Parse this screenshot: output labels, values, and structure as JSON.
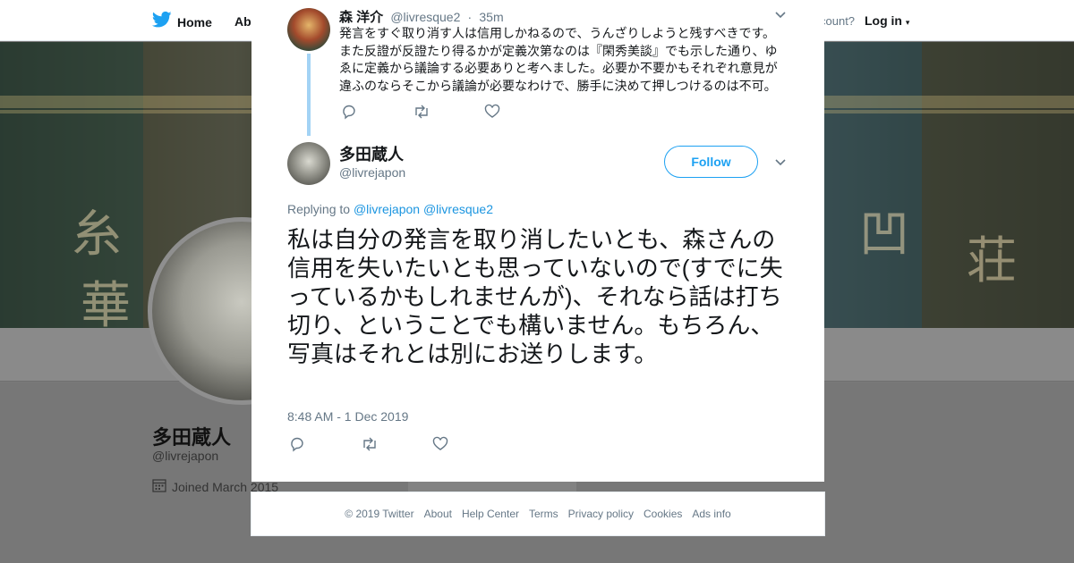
{
  "topbar": {
    "home_label": "Home",
    "about_label": "Abo",
    "account_prompt": "count?",
    "login_label": "Log in"
  },
  "profile": {
    "name": "多田蔵人",
    "handle": "@livrejapon",
    "joined": "Joined March 2015"
  },
  "reply_tweet": {
    "author_name": "森 洋介",
    "author_handle": "@livresque2",
    "separator": "·",
    "time_ago": "35m",
    "text": "発言をすぐ取り消す人は信用しかねるので、うんざりしようと残すべきです。また反證が反證たり得るかが定義次第なのは『閑秀美談』でも示した通り、ゆゑに定義から議論する必要ありと考へました。必要か不要かもそれぞれ意見が違ふのならそこから議論が必要なわけで、勝手に決めて押しつけるのは不可。"
  },
  "main_tweet": {
    "author_name": "多田蔵人",
    "author_handle": "@livrejapon",
    "follow_label": "Follow",
    "replying_prefix": "Replying to",
    "mention_1": "@livrejapon",
    "mention_2": "@livresque2",
    "text": "私は自分の発言を取り消したいとも、森さんの信用を失いたいとも思っていないので(すでに失っているかもしれませんが)、それなら話は打ち切り、ということでも構いません。もちろん、写真はそれとは別にお送りします。",
    "timestamp": "8:48 AM - 1 Dec 2019"
  },
  "footer": {
    "copyright": "© 2019 Twitter",
    "about": "About",
    "help": "Help Center",
    "terms": "Terms",
    "privacy": "Privacy policy",
    "cookies": "Cookies",
    "ads": "Ads info"
  },
  "colors": {
    "twitter_blue": "#1da1f2",
    "link_blue": "#1b95e0",
    "thread_line": "#a3d3f5",
    "secondary_text": "#657786"
  },
  "icons": [
    "twitter-bird-icon",
    "close-icon",
    "chevron-down-icon",
    "reply-icon",
    "retweet-icon",
    "like-icon",
    "calendar-icon"
  ]
}
